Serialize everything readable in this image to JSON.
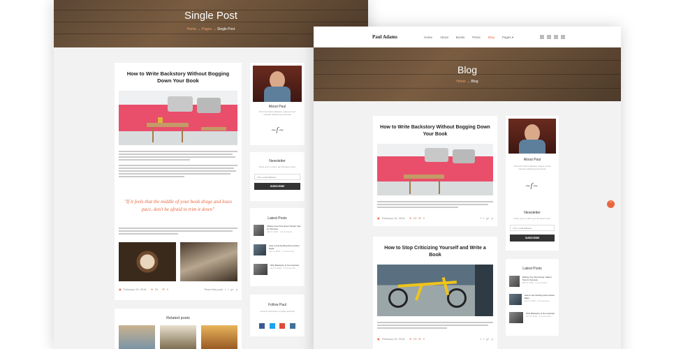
{
  "single": {
    "hero_title": "Single Post",
    "crumbs": {
      "home": "Home",
      "sep1": "→",
      "pages": "Pages",
      "sep2": "→",
      "current": "Single Post"
    },
    "article_title": "How to Write Backstory Without Bogging Down Your Book",
    "quote": "\"If it feels that the middle of your book drags and loses pace, don't be afraid to trim it down\"",
    "meta_date": "February 15, 2016",
    "meta_likes": "23",
    "meta_comments": "0",
    "share_label": "Share this post",
    "related_title": "Related posts"
  },
  "sidebar": {
    "about_title": "About Paul",
    "about_text": "Proin the tellus habitasse magna et sed molestie adipiscing accumsan",
    "newsletter_title": "Newsletter",
    "newsletter_text": "Enter your e-mail to get the latest news",
    "newsletter_placeholder": "Your e-mail address...",
    "subscribe_label": "SUBSCRIBE",
    "latest_title": "Latest Posts",
    "latest": [
      {
        "title": "Writing Your First Novel: Starter Tips for Success",
        "meta": "Mar 8, 2016 · 3 Comments"
      },
      {
        "title": "How to Get Nothing Done before Right",
        "meta": "Dec 8, 2016 · 0 Comments"
      },
      {
        "title": "Why Backstory Is So Important",
        "meta": "Dec 8, 2016 · 3 Comments"
      }
    ],
    "follow_title": "Follow Paul",
    "follow_text": "Connect with Paul on social networks"
  },
  "blog": {
    "logo": "Paul Adams",
    "nav": [
      "Home",
      "About",
      "Books",
      "Press",
      "Blog",
      "Pages ▾"
    ],
    "active_nav": "Blog",
    "hero_title": "Blog",
    "crumbs": {
      "home": "Home",
      "sep": "→",
      "current": "Blog"
    },
    "post1_title": "How to Write Backstory Without Bogging Down Your Book",
    "post1_date": "February 15, 2016",
    "post1_likes": "23",
    "post1_comments": "0",
    "post2_title": "How to Stop Criticizing Yourself and Write a Book",
    "post2_date": "February 15, 2016",
    "post2_likes": "23",
    "post2_comments": "0"
  },
  "colors": {
    "accent": "#e9673f",
    "dark": "#333333",
    "bg": "#f2f2f2"
  },
  "icons": {
    "calendar": "calendar-icon",
    "heart": "heart-icon",
    "comment": "comment-icon",
    "scroll_up": "chevron-up-icon"
  }
}
